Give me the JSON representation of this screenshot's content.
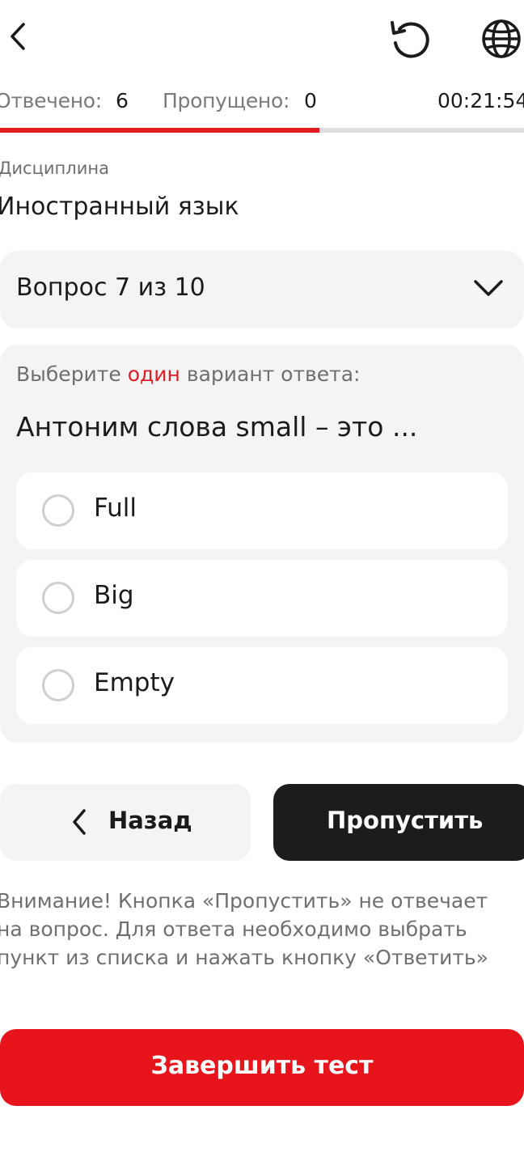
{
  "header": {
    "back_icon": "chevron-left-icon",
    "reset_icon": "rotate-ccw-icon",
    "language_icon": "globe-icon"
  },
  "stats": {
    "answered_label": "Отвечено:",
    "answered_value": "6",
    "skipped_label": "Пропущено:",
    "skipped_value": "0",
    "timer": "00:21:54",
    "progress_fraction": 0.61
  },
  "discipline": {
    "label": "Дисциплина",
    "value": "Иностранный язык"
  },
  "question_selector": {
    "label": "Вопрос 7 из 10",
    "icon": "chevron-down-icon"
  },
  "question": {
    "instruction_prefix": "Выберите ",
    "instruction_accent": "один",
    "instruction_suffix": " вариант ответа:",
    "text": "Антоним слова small – это ...",
    "options": [
      {
        "label": "Full"
      },
      {
        "label": "Big"
      },
      {
        "label": "Empty"
      }
    ]
  },
  "nav": {
    "back_label": "Назад",
    "skip_label": "Пропустить"
  },
  "note": {
    "line1": "Внимание! Кнопка «Пропустить» не отвечает",
    "line2": "на вопрос. Для ответа необходимо выбрать",
    "line3": "пункт из списка и нажать кнопку «Ответить»"
  },
  "finish": {
    "label": "Завершить тест"
  },
  "colors": {
    "accent": "#e11b22",
    "dark_button": "#1c1c1c",
    "surface": "#f4f4f4"
  }
}
